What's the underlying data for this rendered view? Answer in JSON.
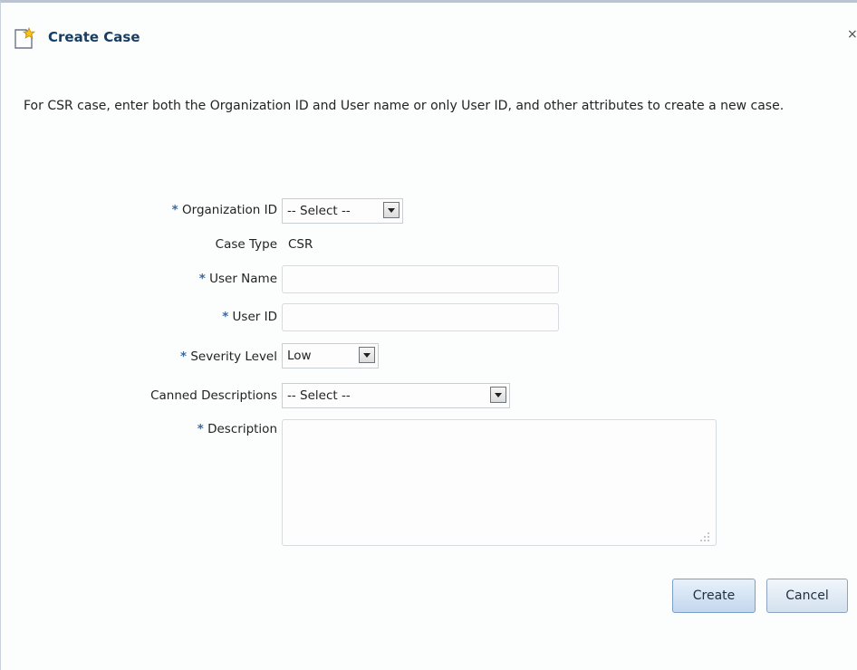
{
  "dialog": {
    "title": "Create Case",
    "title_icon": "new-document-icon",
    "close_label": "×"
  },
  "instructions": "For CSR case, enter both the Organization ID and User name or only User ID, and other attributes to create a new case.",
  "form": {
    "required_marker": "*",
    "organization_id": {
      "label": "Organization ID",
      "selected": "-- Select --"
    },
    "case_type": {
      "label": "Case Type",
      "value": "CSR"
    },
    "user_name": {
      "label": "User Name",
      "value": ""
    },
    "user_id": {
      "label": "User ID",
      "value": ""
    },
    "severity_level": {
      "label": "Severity Level",
      "selected": "Low"
    },
    "canned_descriptions": {
      "label": "Canned Descriptions",
      "selected": "-- Select --"
    },
    "description": {
      "label": "Description",
      "value": ""
    }
  },
  "buttons": {
    "create": "Create",
    "cancel": "Cancel"
  },
  "colors": {
    "title": "#183d63",
    "required_marker": "#3a6a9c",
    "button_border": "#8ca4bf"
  }
}
